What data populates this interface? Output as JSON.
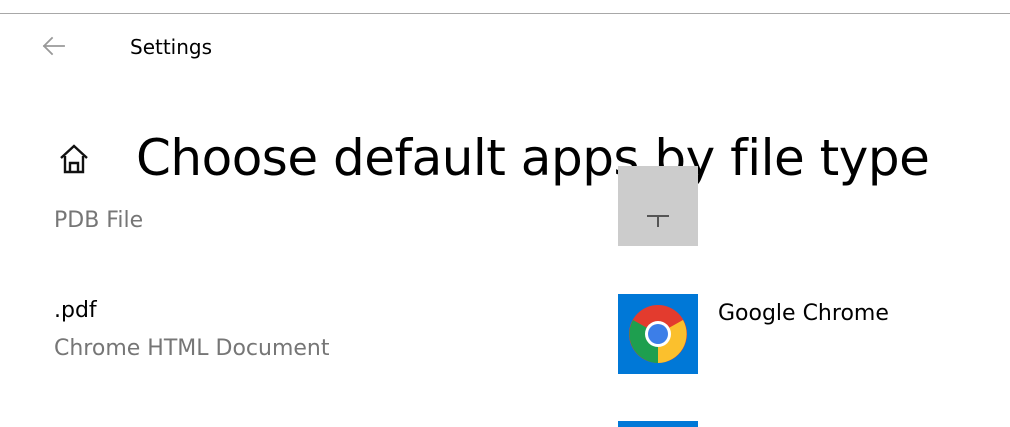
{
  "window": {
    "title": "Settings",
    "back_icon": "back-arrow-icon"
  },
  "header": {
    "home_icon": "home-icon",
    "title": "Choose default apps by file type"
  },
  "rows": [
    {
      "extension": "",
      "description": "PDB File",
      "app": {
        "icon": "plus-icon",
        "name": ""
      }
    },
    {
      "extension": ".pdf",
      "description": "Chrome HTML Document",
      "app": {
        "icon": "chrome-icon",
        "name": "Google Chrome"
      }
    }
  ],
  "colors": {
    "accent": "#0078d7",
    "secondary_text": "#767676",
    "empty_tile": "#cccccc"
  }
}
